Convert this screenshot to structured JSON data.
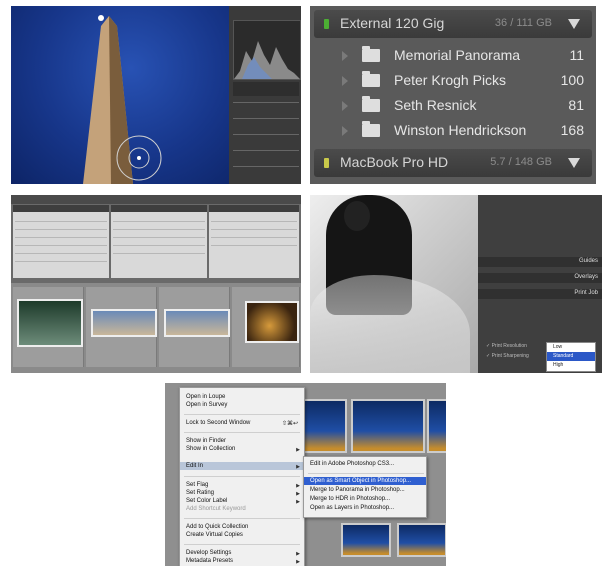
{
  "folders_panel": {
    "external_drive": {
      "name": "External 120 Gig",
      "size": "36 / 111 GB",
      "led_color": "#4caf33"
    },
    "folders": [
      {
        "name": "Memorial Panorama",
        "count": "11"
      },
      {
        "name": "Peter Krogh Picks",
        "count": "100"
      },
      {
        "name": "Seth Resnick",
        "count": "81"
      },
      {
        "name": "Winston Hendrickson",
        "count": "168"
      }
    ],
    "internal_drive": {
      "name": "MacBook Pro HD",
      "size": "5.7 / 148 GB",
      "led_color": "#c9c94a"
    }
  },
  "print_panel": {
    "headers": [
      "Guides",
      "Overlays",
      "Print Job"
    ],
    "items": [
      "Print Resolution",
      "Print Sharpening"
    ],
    "dropdown": [
      "Low",
      "Standard",
      "High"
    ],
    "selected": "Standard"
  },
  "context_menu": {
    "items": [
      "Open in Loupe",
      "Open in Survey",
      "Lock to Second Window",
      "Show in Finder",
      "Show in Collection",
      "Edit In",
      "Set Flag",
      "Set Rating",
      "Set Color Label",
      "Add Shortcut Keyword",
      "Add to Quick Collection",
      "Create Virtual Copies",
      "Develop Settings",
      "Metadata Presets"
    ],
    "shortcut": "⇧⌘↩",
    "submenu": [
      "Edit in Adobe Photoshop CS3...",
      "Open as Smart Object in Photoshop...",
      "Merge to Panorama in Photoshop...",
      "Merge to HDR in Photoshop...",
      "Open as Layers in Photoshop..."
    ]
  },
  "colors": {
    "selection_blue": "#2f5fd0",
    "panel_dark": "#3a3a3a"
  }
}
